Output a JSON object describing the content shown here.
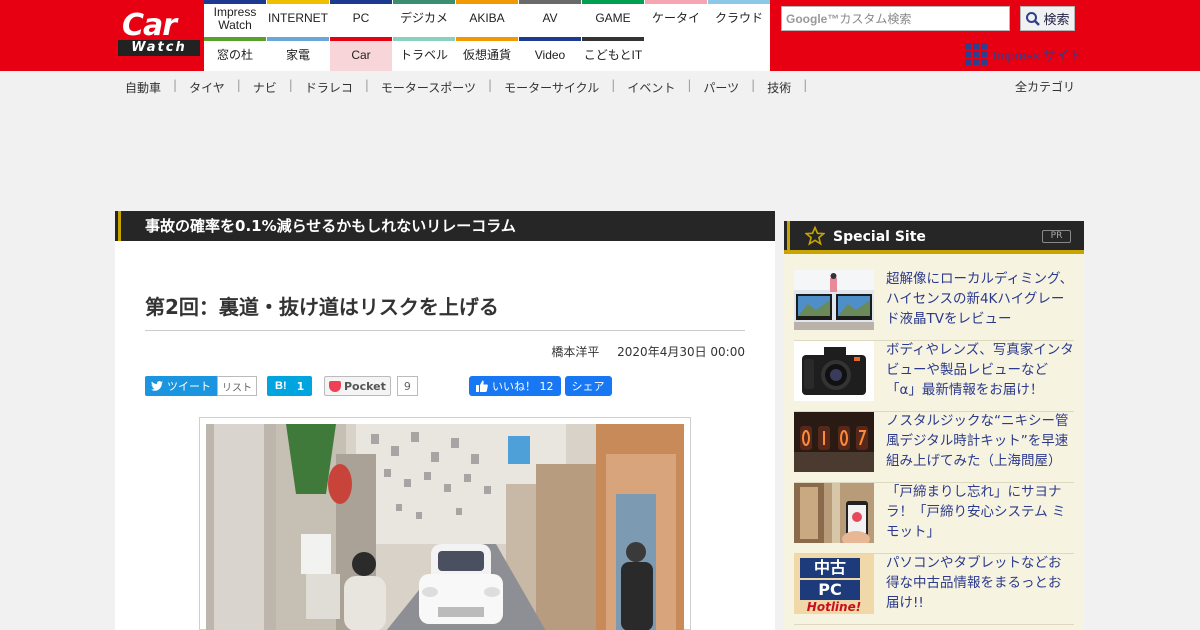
{
  "logo": {
    "line1": "Car",
    "line2": "Watch"
  },
  "site_nav": [
    {
      "label": "Impress\nWatch",
      "color": "#1c3a8f"
    },
    {
      "label": "INTERNET",
      "color": "#f0c000"
    },
    {
      "label": "PC",
      "color": "#1c3a8f"
    },
    {
      "label": "デジカメ",
      "color": "#3b8f70"
    },
    {
      "label": "AKIBA",
      "color": "#f29800"
    },
    {
      "label": "AV",
      "color": "#6a6a6a"
    },
    {
      "label": "GAME",
      "color": "#00a050"
    },
    {
      "label": "ケータイ",
      "color": "#f6a6b2"
    },
    {
      "label": "クラウド",
      "color": "#8cc8e8"
    },
    {
      "label": "窓の杜",
      "color": "#5aa02c"
    },
    {
      "label": "家電",
      "color": "#68a8d8"
    },
    {
      "label": "Car",
      "color": "#e60012",
      "active": true
    },
    {
      "label": "トラベル",
      "color": "#88d0c0"
    },
    {
      "label": "仮想通貨",
      "color": "#f29800"
    },
    {
      "label": "Video",
      "color": "#1c3a8f"
    },
    {
      "label": "こどもとIT",
      "color": "#333333"
    }
  ],
  "search": {
    "brand": "Google™",
    "placeholder": "カスタム検索",
    "button": "検索"
  },
  "impress_site": "Impress サイト",
  "category_nav": [
    "自動車",
    "タイヤ",
    "ナビ",
    "ドラレコ",
    "モータースポーツ",
    "モーターサイクル",
    "イベント",
    "パーツ",
    "技術"
  ],
  "category_sep": "|",
  "all_categories": "全カテゴリ",
  "series_title": "事故の確率を0.1%減らせるかもしれないリレーコラム",
  "article": {
    "title": "第2回：裏道・抜け道はリスクを上げる",
    "author": "橋本洋平",
    "date": "2020年4月30日 00:00"
  },
  "share": {
    "tweet": "ツイート",
    "list": "リスト",
    "hatena_mark": "B!",
    "hatena_count": "1",
    "pocket": "Pocket",
    "pocket_count": "9",
    "like": "いいね！ 12",
    "fb_share": "シェア"
  },
  "sidebar": {
    "title": "Special Site",
    "pr": "PR",
    "items": [
      {
        "text": "超解像にローカルディミング、ハイセンスの新4Kハイグレード液晶TVをレビュー",
        "thumb": "tv"
      },
      {
        "text": "ボディやレンズ、写真家インタビューや製品レビューなど「α」最新情報をお届け！",
        "thumb": "camera"
      },
      {
        "text": "ノスタルジックな“ニキシー管風デジタル時計キット”を早速組み上げてみた（上海問屋）",
        "thumb": "nixie"
      },
      {
        "text": "「戸締まりし忘れ」にサヨナラ！「戸締り安心システム ミモット」",
        "thumb": "phone"
      },
      {
        "text": "パソコンやタブレットなどお得な中古品情報をまるっとお届け!!",
        "thumb": "pc",
        "thumb_lines": [
          "中古",
          "PC",
          "Hotline!"
        ]
      }
    ]
  },
  "colors": {
    "brand_red": "#e60012",
    "accent_gold": "#c8a400",
    "link_blue": "#2b3a8c",
    "impress_blue": "#2d3f8f"
  }
}
